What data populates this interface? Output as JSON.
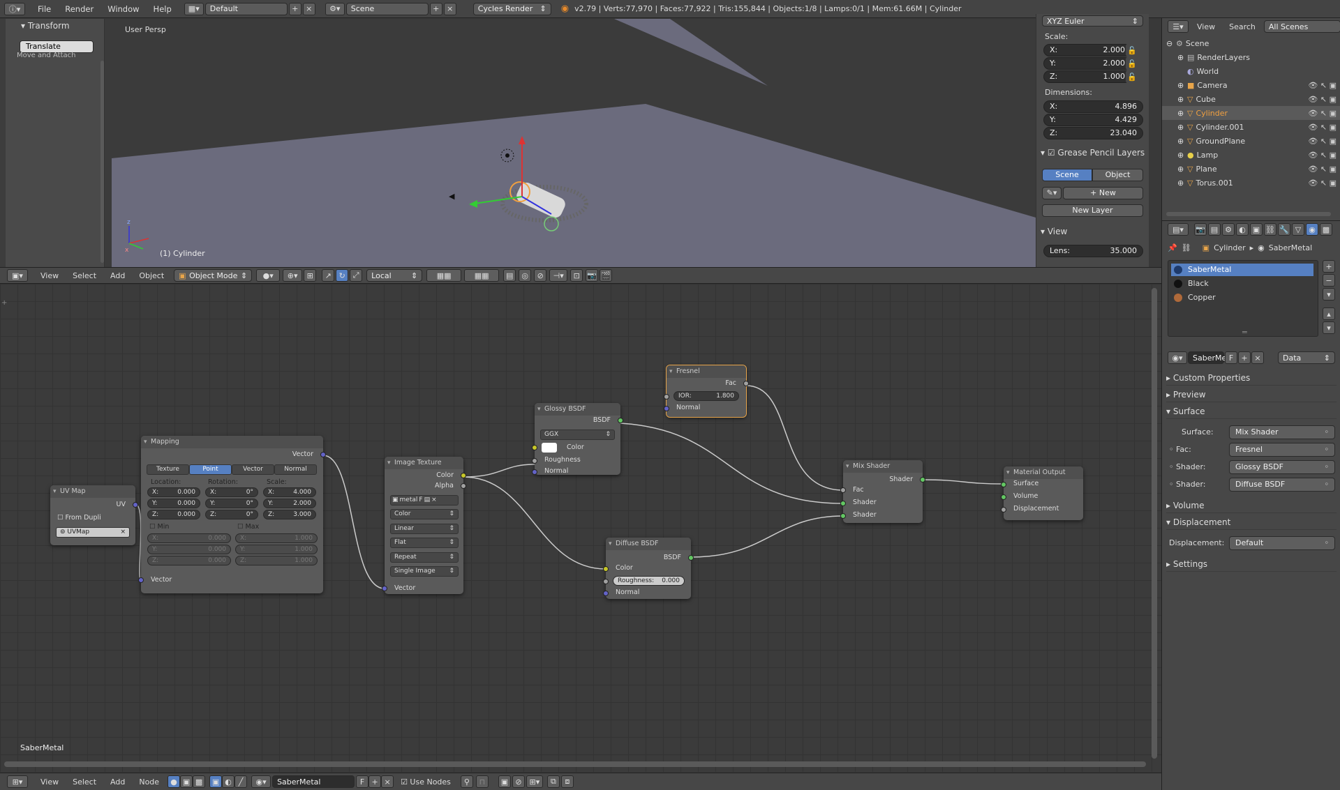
{
  "topbar": {
    "menus": [
      "File",
      "Render",
      "Window",
      "Help"
    ],
    "screen_layout": "Default",
    "scene": "Scene",
    "engine": "Cycles Render",
    "stats": "v2.79 | Verts:77,970 | Faces:77,922 | Tris:155,844 | Objects:1/8 | Lamps:0/1 | Mem:61.66M | Cylinder"
  },
  "toolshelf": {
    "panel_title": "Transform",
    "translate_btn": "Translate",
    "cut_text": "Move and Attach"
  },
  "viewport": {
    "label": "User Persp",
    "object_label": "(1) Cylinder"
  },
  "npanel": {
    "rotation_mode": "XYZ Euler",
    "scale_label": "Scale:",
    "scale": [
      {
        "axis": "X:",
        "value": "2.000"
      },
      {
        "axis": "Y:",
        "value": "2.000"
      },
      {
        "axis": "Z:",
        "value": "1.000"
      }
    ],
    "dimensions_label": "Dimensions:",
    "dimensions": [
      {
        "axis": "X:",
        "value": "4.896"
      },
      {
        "axis": "Y:",
        "value": "4.429"
      },
      {
        "axis": "Z:",
        "value": "23.040"
      }
    ],
    "grease_title": "Grease Pencil Layers",
    "scene_tab": "Scene",
    "object_tab": "Object",
    "new_btn": "New",
    "new_layer_btn": "New Layer",
    "view_title": "View",
    "lens_label": "Lens:",
    "lens_value": "35.000"
  },
  "view3d_header": {
    "menus": [
      "View",
      "Select",
      "Add",
      "Object"
    ],
    "mode": "Object Mode",
    "orientation": "Local"
  },
  "outliner": {
    "menus": [
      "View",
      "Search"
    ],
    "filter": "All Scenes",
    "rows": [
      {
        "name": "Scene",
        "icon": "scene-icon"
      },
      {
        "name": "RenderLayers",
        "icon": "renderlayers-icon"
      },
      {
        "name": "World",
        "icon": "world-icon"
      },
      {
        "name": "Camera",
        "icon": "camera-icon"
      },
      {
        "name": "Cube",
        "icon": "mesh-icon"
      },
      {
        "name": "Cylinder",
        "icon": "mesh-icon"
      },
      {
        "name": "Cylinder.001",
        "icon": "mesh-icon"
      },
      {
        "name": "GroundPlane",
        "icon": "mesh-icon"
      },
      {
        "name": "Lamp",
        "icon": "lamp-icon"
      },
      {
        "name": "Plane",
        "icon": "mesh-icon"
      },
      {
        "name": "Torus.001",
        "icon": "mesh-icon"
      }
    ]
  },
  "props": {
    "breadcrumb": [
      "Cylinder",
      "SaberMetal"
    ],
    "materials": [
      {
        "name": "SaberMetal",
        "color": "#1e3a6b"
      },
      {
        "name": "Black",
        "color": "#111111"
      },
      {
        "name": "Copper",
        "color": "#b06a3a"
      }
    ],
    "material_field": "SaberMet",
    "f_label": "F",
    "data_select": "Data",
    "sections": {
      "custom": "Custom Properties",
      "preview": "Preview",
      "surface": "Surface",
      "volume": "Volume",
      "displacement": "Displacement",
      "settings": "Settings"
    },
    "surface_label": "Surface:",
    "surface_value": "Mix Shader",
    "fac_label": "Fac:",
    "fac_value": "Fresnel",
    "shader_label": "Shader:",
    "shader1_value": "Glossy BSDF",
    "shader2_value": "Diffuse BSDF",
    "disp_label": "Displacement:",
    "disp_value": "Default"
  },
  "nodes": {
    "uvmap": {
      "title": "UV Map",
      "out": "UV",
      "from_dupli": "From Dupli",
      "map": "UVMap"
    },
    "mapping": {
      "title": "Mapping",
      "out": "Vector",
      "in": "Vector",
      "tabs": [
        "Texture",
        "Point",
        "Vector",
        "Normal"
      ],
      "loc_label": "Location:",
      "rot_label": "Rotation:",
      "scale_label": "Scale:",
      "loc": [
        "0.000",
        "0.000",
        "0.000"
      ],
      "rot": [
        "0°",
        "0°",
        "0°"
      ],
      "scl": [
        "4.000",
        "2.000",
        "3.000"
      ],
      "axes": [
        "X:",
        "Y:",
        "Z:"
      ],
      "min_label": "Min",
      "max_label": "Max",
      "min": [
        "0.000",
        "0.000",
        "0.000"
      ],
      "max": [
        "1.000",
        "1.000",
        "1.000"
      ]
    },
    "image": {
      "title": "Image Texture",
      "out1": "Color",
      "out2": "Alpha",
      "in": "Vector",
      "image_name": "metal",
      "f": "F",
      "color_space": "Color",
      "interp": "Linear",
      "projection": "Flat",
      "extension": "Repeat",
      "source": "Single Image"
    },
    "glossy": {
      "title": "Glossy BSDF",
      "out": "BSDF",
      "dist": "GGX",
      "color": "Color",
      "rough": "Roughness",
      "normal": "Normal"
    },
    "fresnel": {
      "title": "Fresnel",
      "out": "Fac",
      "ior_label": "IOR:",
      "ior": "1.800",
      "normal": "Normal"
    },
    "diffuse": {
      "title": "Diffuse BSDF",
      "out": "BSDF",
      "color": "Color",
      "rough_label": "Roughness:",
      "rough": "0.000",
      "normal": "Normal"
    },
    "mix": {
      "title": "Mix Shader",
      "out": "Shader",
      "fac": "Fac",
      "sh1": "Shader",
      "sh2": "Shader"
    },
    "output": {
      "title": "Material Output",
      "surface": "Surface",
      "volume": "Volume",
      "disp": "Displacement"
    }
  },
  "node_editor": {
    "material_label": "SaberMetal"
  },
  "node_header": {
    "menus": [
      "View",
      "Select",
      "Add",
      "Node"
    ],
    "material": "SaberMetal",
    "f": "F",
    "use_nodes": "Use Nodes"
  }
}
